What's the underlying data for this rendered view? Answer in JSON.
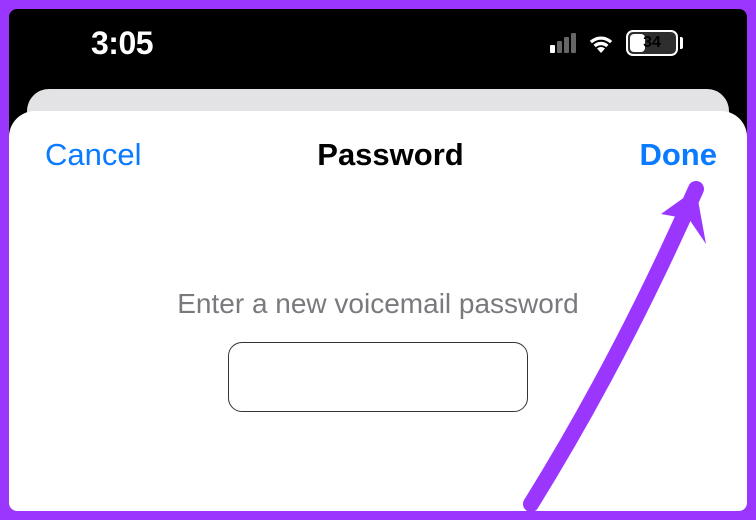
{
  "status": {
    "time": "3:05",
    "battery_pct": "34",
    "signal_bars_on": 1
  },
  "sheet": {
    "cancel_label": "Cancel",
    "title": "Password",
    "done_label": "Done",
    "prompt": "Enter a new voicemail password",
    "password_value": ""
  },
  "annotation": {
    "arrow_color": "#9b36ff"
  }
}
